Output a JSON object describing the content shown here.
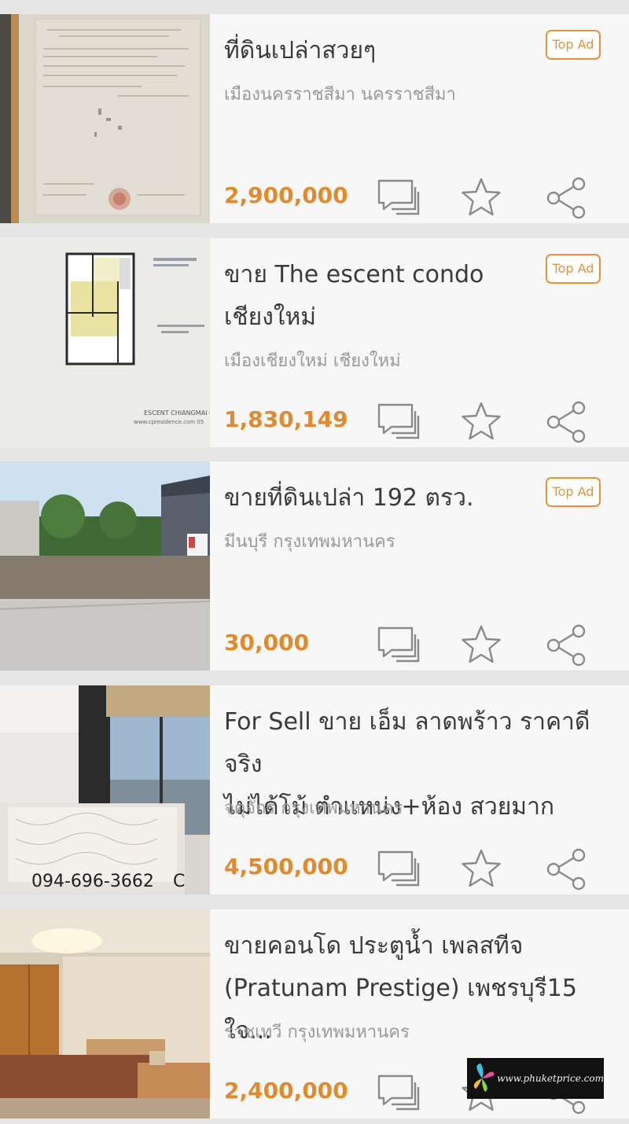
{
  "listings": [
    {
      "title": "ที่ดินเปล่าสวยๆ",
      "badge": "Top Ad",
      "location": "เมืองนครราชสีมา นครราชสีมา",
      "price": "2,900,000",
      "thumbnail": "land-title-deed-document"
    },
    {
      "title": "ขาย The escent condo\nเชียงใหม่",
      "badge": "Top Ad",
      "location": "เมืองเชียงใหม่ เชียงใหม่",
      "price": "1,830,149",
      "thumbnail": "condo-floor-plan",
      "thumb_text_1": "ESCENT CHIANGMAI CO",
      "thumb_text_2": "www.cpresidence.com 05"
    },
    {
      "title": "ขายที่ดินเปล่า  192  ตรว.",
      "badge": "Top Ad",
      "location": "มีนบุรี กรุงเทพมหานคร",
      "price": "30,000",
      "thumbnail": "empty-land-lot"
    },
    {
      "title": "For Sell ขาย เอ็ม ลาดพร้าว ราคาดีจริง\nไม่ได้โม้ ตำแหน่ง+ห้อง สวยมาก",
      "location": "จตุจักร กรุงเทพมหานคร",
      "price": "4,500,000",
      "thumbnail": "bedroom-with-window",
      "thumb_text_1": "094-696-3662",
      "thumb_text_2": "C"
    },
    {
      "title": "ขายคอนโด ประตูน้ำ เพลสทีจ\n(Pratunam Prestige) เพชรบุรี15 ใจ...",
      "location": "ราชเทวี กรุงเทพมหานคร",
      "price": "2,400,000",
      "thumbnail": "condo-bedroom-wardrobe"
    }
  ],
  "actions": {
    "chat_icon": "chat-bubbles-icon",
    "favorite_icon": "star-icon",
    "share_icon": "share-icon"
  },
  "colors": {
    "price": "#e28a2b",
    "badge": "#e6923a",
    "title": "#3a3a3a",
    "location": "#9a9a9a",
    "icon": "#8a8a8a",
    "card_bg": "#f7f7f7",
    "divider": "#e6e6e6"
  },
  "watermark": {
    "text": "www.phuketprice.com"
  }
}
